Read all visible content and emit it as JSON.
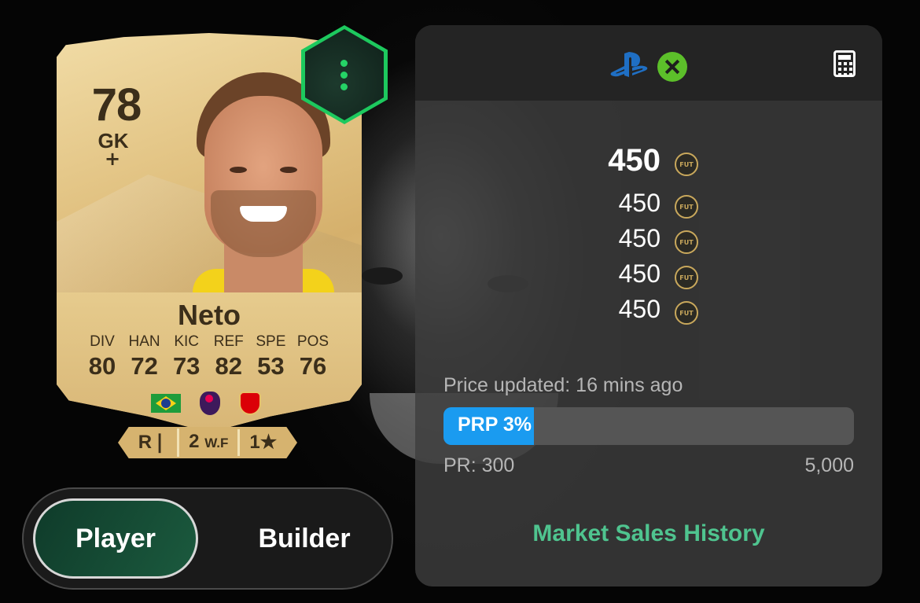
{
  "card": {
    "rating": "78",
    "position": "GK",
    "plus": "+",
    "name": "Neto",
    "stats": [
      {
        "label": "DIV",
        "value": "80"
      },
      {
        "label": "HAN",
        "value": "72"
      },
      {
        "label": "KIC",
        "value": "73"
      },
      {
        "label": "REF",
        "value": "82"
      },
      {
        "label": "SPE",
        "value": "53"
      },
      {
        "label": "POS",
        "value": "76"
      }
    ],
    "nation_icon": "brazil-flag-icon",
    "league_icon": "premier-league-icon",
    "club_icon": "arsenal-crest-icon",
    "traits": {
      "preferred_foot": "R",
      "preferred_foot_icon": "boot-icon",
      "weak_foot_value": "2",
      "weak_foot_label": "W.F",
      "skill_moves_value": "1",
      "skill_moves_icon": "star-icon"
    }
  },
  "menu_button_icon": "vertical-dots-icon",
  "toggle": {
    "player_label": "Player",
    "builder_label": "Builder",
    "selected": "Player"
  },
  "panel": {
    "platform_icons": [
      "playstation-icon",
      "xbox-icon"
    ],
    "calculator_icon": "calculator-icon",
    "prices": [
      "450",
      "450",
      "450",
      "450",
      "450"
    ],
    "coin_label": "FUT",
    "updated_text": "Price updated: 16 mins ago",
    "prp_label": "PRP 3%",
    "prp_percent": 3,
    "pr_min": "PR: 300",
    "pr_max": "5,000",
    "history_link": "Market Sales History"
  },
  "colors": {
    "accent_green": "#1dc95e",
    "link_green": "#4fc48f",
    "prp_blue": "#1a9bf0",
    "card_gold": "#e2c383"
  }
}
